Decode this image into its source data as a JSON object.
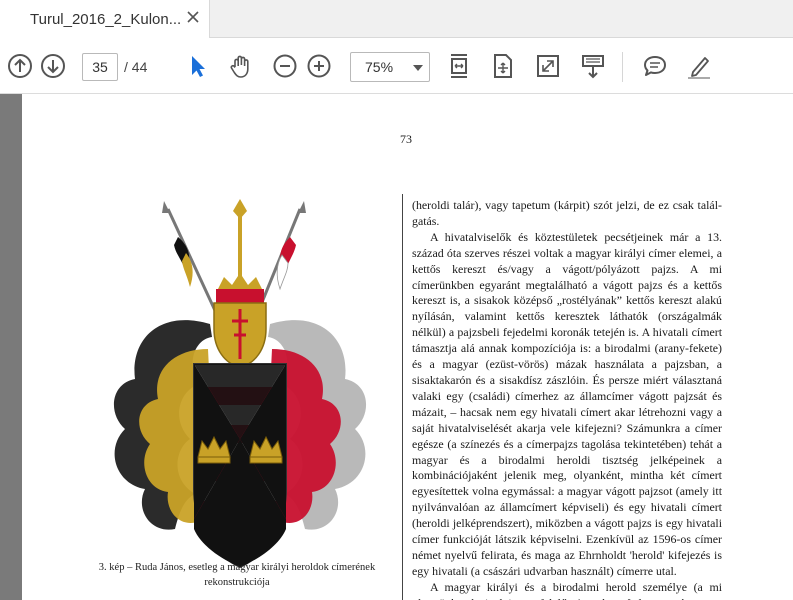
{
  "tab": {
    "title": "Turul_2016_2_Kulon...",
    "close_icon": "close-icon"
  },
  "toolbar": {
    "page_current": "35",
    "page_total": "/ 44",
    "zoom": "75%",
    "icons": [
      "arrow-up-circle-icon",
      "arrow-down-circle-icon",
      "select-cursor-icon",
      "hand-tool-icon",
      "zoom-out-icon",
      "zoom-in-icon",
      "fit-page-icon",
      "rotate-page-icon",
      "fullscreen-icon",
      "scroll-mode-icon",
      "comment-icon",
      "highlight-pen-icon"
    ]
  },
  "document": {
    "page_number": "73",
    "caption": "3. kép – Ruda János, esetleg a magyar királyi heroldok címerének rekonstrukciója",
    "paragraphs": [
      "(heroldi talár), vagy tapetum (kárpit) szót jelzi, de ez csak talál­gatás.",
      "A hivatalviselők és köztestületek pecsétjeinek már a 13. század óta szerves részei voltak a magyar királyi címer ele­mei, a kettős kereszt és/vagy a vágott/pólyázott pajzs. A mi címerünkben egyaránt megtalálható a vágott pajzs és a ket­tős kereszt is, a sisakok középső „rostélyának” kettős kereszt alakú nyílásán, valamint kettős keresztek láthatók (országal­mák nélkül) a pajzsbeli fejedelmi koronák tetején is. A hiva­tali címert támasztja alá annak kompozíciója is: a birodalmi (arany-fekete) és a magyar (ezüst-vörös) mázak használata a pajzsban, a sisaktakarón és a sisakdísz zászlóin. És persze miért választaná valaki egy (családi) címerhez az államcímer vágott pajzsát és mázait, – hacsak nem egy hivatali címert akar létrehozni vagy a saját hivatalviselését akarja vele kife­jezni? Számunkra a címer egésze (a színezés és a címer­pajzs tagolása tekintetében) tehát a magyar és a birodalmi heroldi tisztség jelképeinek a kombinációjaként jelenik meg, olyanként, mintha két címert egyesítettek volna egymással: a magyar vágott pajzsot (amely itt nyilvánvalóan az állam­címert képviseli) és egy hivatali címert (heroldi jelképrend­szert), miközben a vágott pajzs is egy hivatali címer funkcióját látszik képviselni. Ezenkívül az 1596-os címer német nyelvű felirata, és maga az Ehrnholdt 'herold' kifejezés is egy hiva­tali (a császári udvarban használt) címerre utal.",
      "A magyar királyi és a birodalmi herold személye (a mi címerünk mázainak is megfelelően) gyakran fedte egymást."
    ]
  }
}
